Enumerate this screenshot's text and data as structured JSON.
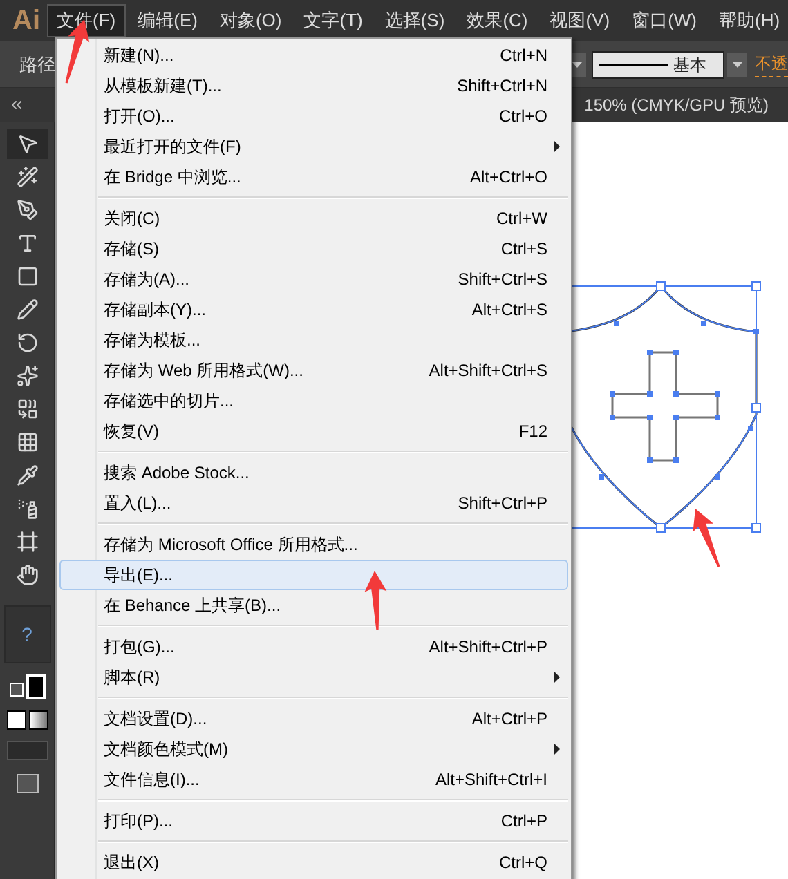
{
  "app_logo": "Ai",
  "menubar": [
    {
      "label": "文件(F)",
      "selected": true
    },
    {
      "label": "编辑(E)",
      "selected": false
    },
    {
      "label": "对象(O)",
      "selected": false
    },
    {
      "label": "文字(T)",
      "selected": false
    },
    {
      "label": "选择(S)",
      "selected": false
    },
    {
      "label": "效果(C)",
      "selected": false
    },
    {
      "label": "视图(V)",
      "selected": false
    },
    {
      "label": "窗口(W)",
      "selected": false
    },
    {
      "label": "帮助(H)",
      "selected": false
    }
  ],
  "control_bar": {
    "label": "路径",
    "stroke_style": "基本",
    "opacity_label": "不透"
  },
  "document_tab": "150% (CMYK/GPU 预览)",
  "tools": [
    {
      "kind": "select",
      "selected": true
    },
    {
      "kind": "wand",
      "selected": false
    },
    {
      "kind": "pen",
      "selected": false
    },
    {
      "kind": "type",
      "selected": false
    },
    {
      "kind": "rect",
      "selected": false
    },
    {
      "kind": "pencil",
      "selected": false
    },
    {
      "kind": "rotate",
      "selected": false
    },
    {
      "kind": "warp",
      "selected": false
    },
    {
      "kind": "builder",
      "selected": false
    },
    {
      "kind": "mesh",
      "selected": false
    },
    {
      "kind": "eyedropper",
      "selected": false
    },
    {
      "kind": "spray",
      "selected": false
    },
    {
      "kind": "artboard",
      "selected": false
    },
    {
      "kind": "hand",
      "selected": false
    }
  ],
  "help_label": "?",
  "file_menu": [
    [
      {
        "label": "新建(N)...",
        "shortcut": "Ctrl+N",
        "submenu": false,
        "selected": false
      },
      {
        "label": "从模板新建(T)...",
        "shortcut": "Shift+Ctrl+N",
        "submenu": false,
        "selected": false
      },
      {
        "label": "打开(O)...",
        "shortcut": "Ctrl+O",
        "submenu": false,
        "selected": false
      },
      {
        "label": "最近打开的文件(F)",
        "submenu": true,
        "selected": false
      },
      {
        "label": "在 Bridge 中浏览...",
        "shortcut": "Alt+Ctrl+O",
        "submenu": false,
        "selected": false
      }
    ],
    [
      {
        "label": "关闭(C)",
        "shortcut": "Ctrl+W",
        "submenu": false,
        "selected": false
      },
      {
        "label": "存储(S)",
        "shortcut": "Ctrl+S",
        "submenu": false,
        "selected": false
      },
      {
        "label": "存储为(A)...",
        "shortcut": "Shift+Ctrl+S",
        "submenu": false,
        "selected": false
      },
      {
        "label": "存储副本(Y)...",
        "shortcut": "Alt+Ctrl+S",
        "submenu": false,
        "selected": false
      },
      {
        "label": "存储为模板...",
        "submenu": false,
        "selected": false
      },
      {
        "label": "存储为 Web 所用格式(W)...",
        "shortcut": "Alt+Shift+Ctrl+S",
        "submenu": false,
        "selected": false
      },
      {
        "label": "存储选中的切片...",
        "submenu": false,
        "selected": false
      },
      {
        "label": "恢复(V)",
        "shortcut": "F12",
        "submenu": false,
        "selected": false
      }
    ],
    [
      {
        "label": "搜索 Adobe Stock...",
        "submenu": false,
        "selected": false
      },
      {
        "label": "置入(L)...",
        "shortcut": "Shift+Ctrl+P",
        "submenu": false,
        "selected": false
      }
    ],
    [
      {
        "label": "存储为 Microsoft Office 所用格式...",
        "submenu": false,
        "selected": false
      },
      {
        "label": "导出(E)...",
        "submenu": false,
        "selected": true
      },
      {
        "label": "在 Behance 上共享(B)...",
        "submenu": false,
        "selected": false
      }
    ],
    [
      {
        "label": "打包(G)...",
        "shortcut": "Alt+Shift+Ctrl+P",
        "submenu": false,
        "selected": false
      },
      {
        "label": "脚本(R)",
        "submenu": true,
        "selected": false
      }
    ],
    [
      {
        "label": "文档设置(D)...",
        "shortcut": "Alt+Ctrl+P",
        "submenu": false,
        "selected": false
      },
      {
        "label": "文档颜色模式(M)",
        "submenu": true,
        "selected": false
      },
      {
        "label": "文件信息(I)...",
        "shortcut": "Alt+Shift+Ctrl+I",
        "submenu": false,
        "selected": false
      }
    ],
    [
      {
        "label": "打印(P)...",
        "shortcut": "Ctrl+P",
        "submenu": false,
        "selected": false
      }
    ],
    [
      {
        "label": "退出(X)",
        "shortcut": "Ctrl+Q",
        "submenu": false,
        "selected": false
      }
    ]
  ]
}
